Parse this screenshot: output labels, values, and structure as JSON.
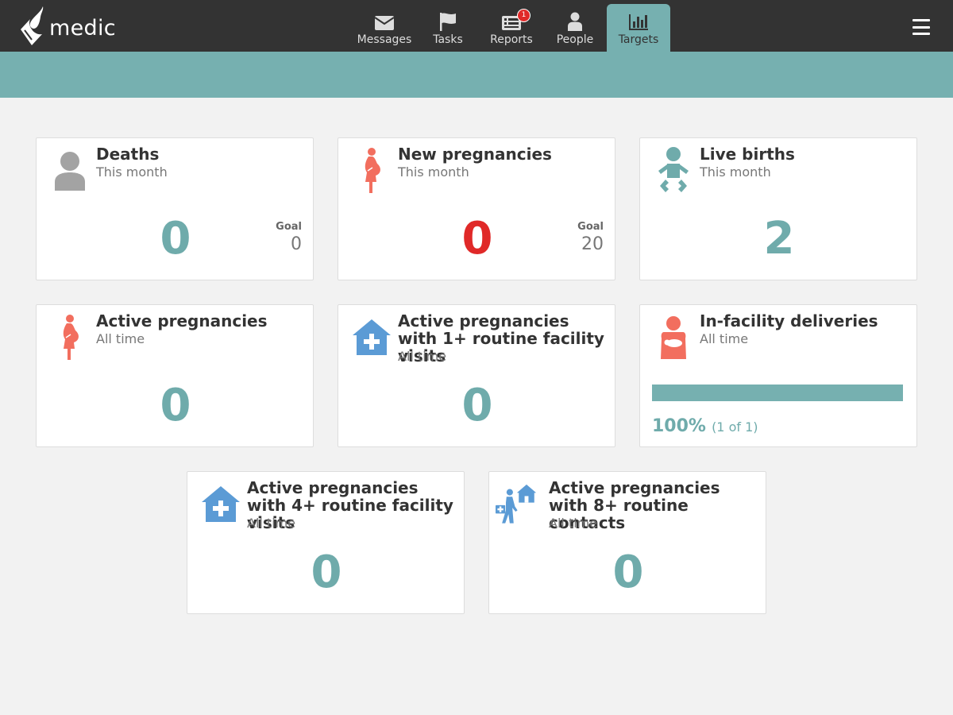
{
  "app": {
    "logo_text": "medic"
  },
  "nav": {
    "tabs": [
      {
        "label": "Messages",
        "icon": "envelope-icon"
      },
      {
        "label": "Tasks",
        "icon": "flag-icon"
      },
      {
        "label": "Reports",
        "icon": "list-icon",
        "badge": "1"
      },
      {
        "label": "People",
        "icon": "person-icon"
      },
      {
        "label": "Targets",
        "icon": "bar-chart-icon",
        "active": true
      }
    ]
  },
  "colors": {
    "header": "#333333",
    "accent": "#76b0b0",
    "count": "#6fabab",
    "alert": "#e02928",
    "pregnancy": "#f26e5e",
    "facility": "#5b9bd5"
  },
  "targets": [
    {
      "title": "Deaths",
      "subtitle": "This month",
      "icon": "person-silhouette-icon",
      "count": "0",
      "goal_label": "Goal",
      "goal": "0"
    },
    {
      "title": "New pregnancies",
      "subtitle": "This month",
      "icon": "pregnant-woman-icon",
      "count": "0",
      "goal_label": "Goal",
      "goal": "20"
    },
    {
      "title": "Live births",
      "subtitle": "This month",
      "icon": "baby-icon",
      "count": "2"
    },
    {
      "title": "Active pregnancies",
      "subtitle": "All time",
      "icon": "pregnant-woman-icon",
      "count": "0"
    },
    {
      "title": "Active pregnancies with 1+ routine facility visits",
      "subtitle": "All time",
      "icon": "health-facility-icon",
      "count": "0"
    },
    {
      "title": "In-facility deliveries",
      "subtitle": "All time",
      "icon": "mother-baby-icon",
      "progress_percent": 100,
      "progress_label": "100%",
      "progress_fraction": "(1 of 1)"
    },
    {
      "title": "Active pregnancies with 4+ routine facility visits",
      "subtitle": "All time",
      "icon": "health-facility-icon",
      "count": "0"
    },
    {
      "title": "Active pregnancies with 8+ routine contacts",
      "subtitle": "All time",
      "icon": "health-worker-visit-icon",
      "count": "0"
    }
  ]
}
